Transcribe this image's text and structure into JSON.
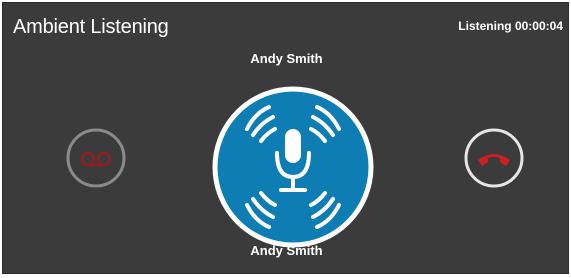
{
  "header": {
    "title": "Ambient Listening",
    "status": "Listening 00:00:04"
  },
  "caller": {
    "name_top": "Andy Smith",
    "name_bottom": "Andy Smith"
  },
  "icons": {
    "voicemail": "voicemail-icon",
    "microphone": "microphone-icon",
    "hangup": "phone-hangup-icon"
  },
  "colors": {
    "background": "#3b3b3b",
    "mic_blue": "#0e7db3",
    "hangup_red": "#cc1f1f",
    "voicemail_red": "#8e1f1f",
    "ring_white": "#ffffff",
    "ring_grey": "#8a8a8a"
  }
}
